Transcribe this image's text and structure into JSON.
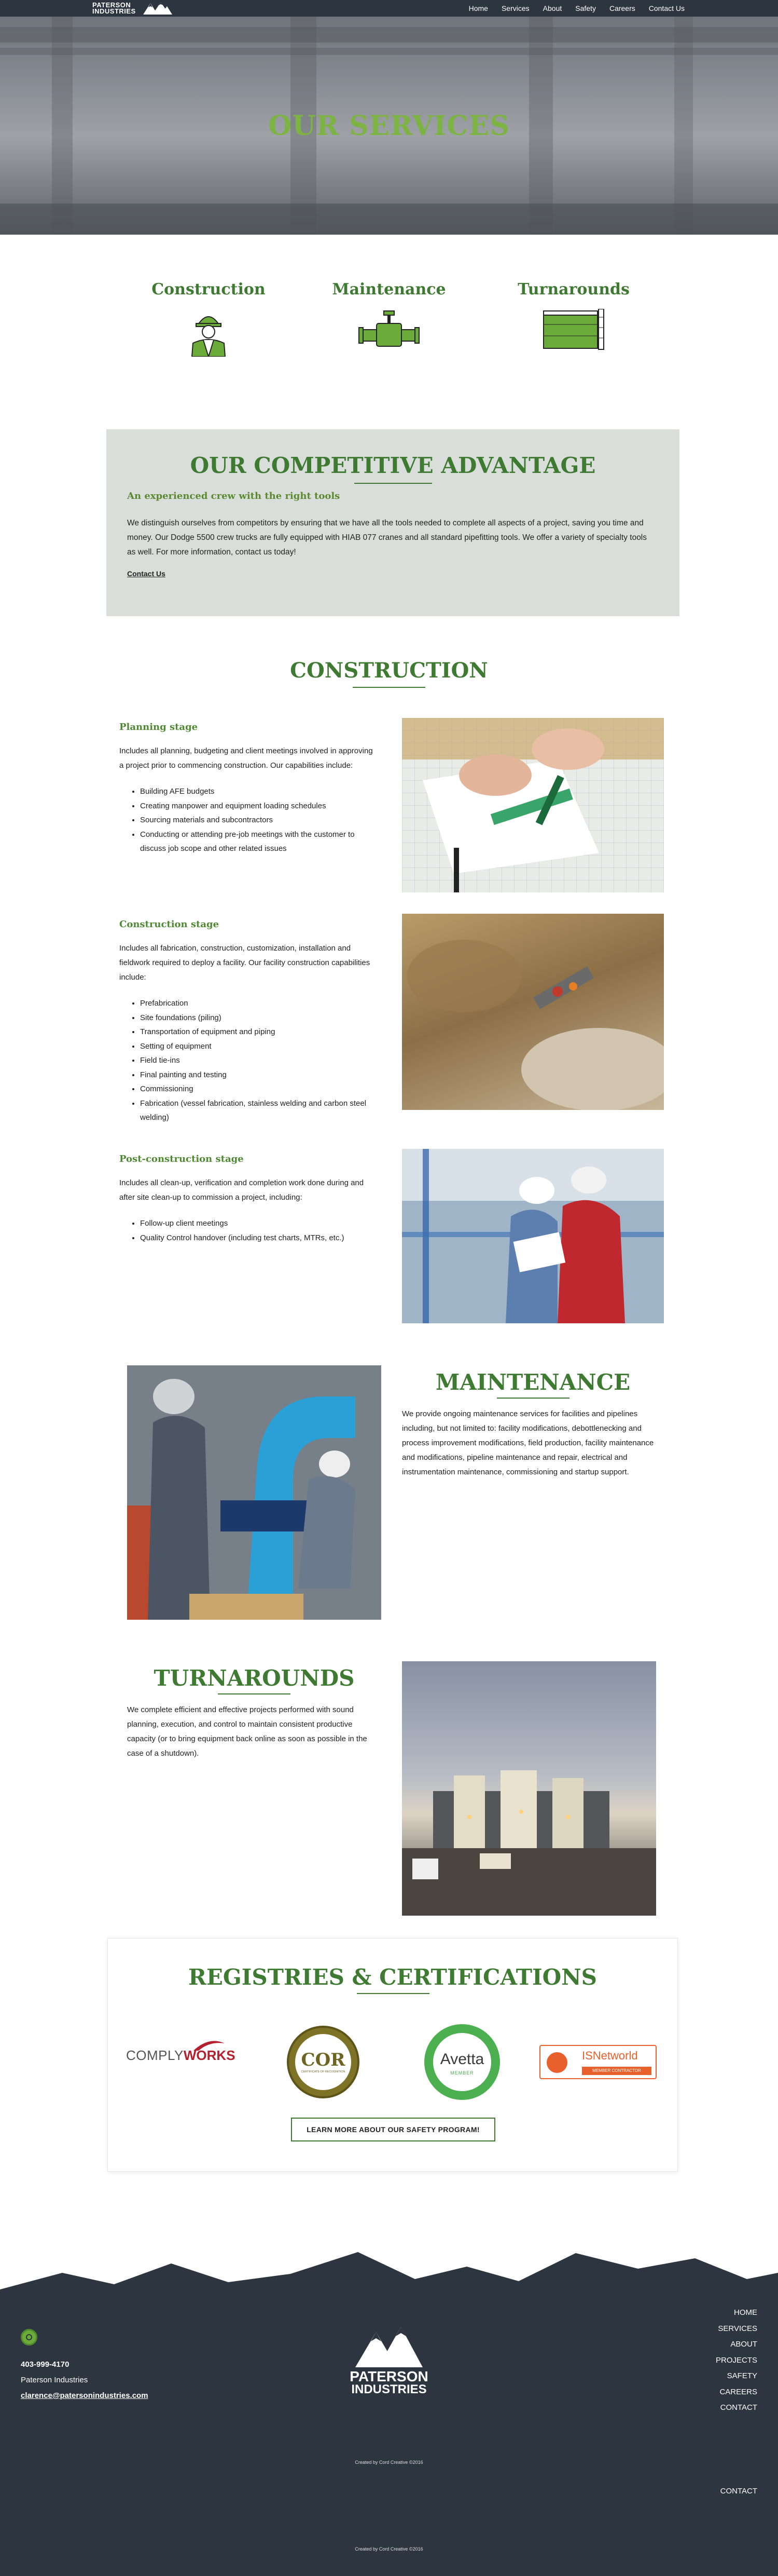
{
  "nav": {
    "logo_top": "PATERSON",
    "logo_bottom": "INDUSTRIES",
    "items": [
      "Home",
      "Services",
      "About",
      "Safety",
      "Careers",
      "Contact Us"
    ]
  },
  "hero": {
    "title": "OUR SERVICES"
  },
  "services": [
    {
      "label": "Construction",
      "icon": "worker-icon"
    },
    {
      "label": "Maintenance",
      "icon": "valve-icon"
    },
    {
      "label": "Turnarounds",
      "icon": "tank-icon"
    }
  ],
  "advantage": {
    "title": "OUR COMPETITIVE ADVANTAGE",
    "subtitle": "An experienced crew with the right tools",
    "body": "We distinguish ourselves from competitors by ensuring that we have all the tools needed to complete all aspects of a project, saving you time and money. Our Dodge 5500 crew trucks are fully equipped with HIAB 077 cranes and all standard pipefitting tools. We offer a variety of specialty tools as well. For more information, contact us today!",
    "link": "Contact Us"
  },
  "construction": {
    "title": "CONSTRUCTION",
    "stages": [
      {
        "title": "Planning stage",
        "body": "Includes all planning, budgeting and client meetings involved in approving a project prior to commencing construction. Our capabilities include:",
        "items": [
          "Building AFE budgets",
          "Creating manpower and equipment loading schedules",
          "Sourcing materials and subcontractors",
          "Conducting or attending pre-job meetings with the customer to discuss job scope and other related issues"
        ]
      },
      {
        "title": "Construction stage",
        "body": "Includes all fabrication, construction, customization, installation and fieldwork required to deploy a facility. Our facility construction capabilities include:",
        "items": [
          "Prefabrication",
          "Site foundations (piling)",
          "Transportation of equipment and piping",
          "Setting of equipment",
          "Field tie-ins",
          "Final painting and testing",
          "Commissioning",
          "Fabrication (vessel fabrication, stainless welding and carbon steel welding)"
        ]
      },
      {
        "title": "Post-construction stage",
        "body": "Includes all clean-up, verification and completion work done during and after site clean-up to commission a project, including:",
        "items": [
          "Follow-up client meetings",
          "Quality Control handover (including test charts, MTRs, etc.)"
        ]
      }
    ]
  },
  "maintenance": {
    "title": "MAINTENANCE",
    "body": "We provide ongoing maintenance services for facilities and pipelines including, but not limited to: facility modifications, debottlenecking and process improvement modifications, field production, facility maintenance and modifications, pipeline maintenance and repair, electrical and instrumentation maintenance, commissioning and startup support."
  },
  "turnarounds": {
    "title": "TURNAROUNDS",
    "body": "We complete efficient and effective projects performed with sound planning, execution, and control to maintain consistent productive capacity (or to bring equipment back online as soon as possible in the case of a shutdown)."
  },
  "registries": {
    "title": "REGISTRIES & CERTIFICATIONS",
    "logos": {
      "comply_a": "COMPLY",
      "comply_b": "WORKS",
      "cor": "COR",
      "cor_ring": "CERTIFICATE OF RECOGNITION",
      "avetta": "Avetta",
      "avetta_sub": "MEMBER",
      "isn": "ISNetworld",
      "isn_sub": "MEMBER CONTRACTOR"
    },
    "button": "LEARN MORE ABOUT OUR SAFETY PROGRAM!"
  },
  "footer": {
    "nav": [
      "HOME",
      "SERVICES",
      "ABOUT",
      "PROJECTS",
      "SAFETY",
      "CAREERS",
      "CONTACT"
    ],
    "phone": "403-999-4170",
    "company": "Paterson Industries",
    "email": "clarence@patersonindustries.com",
    "logo_top": "PATERSON",
    "logo_bottom": "INDUSTRIES",
    "credit1": "Created by Cord Creative ©2016",
    "contact2": "CONTACT",
    "credit2": "Created by Cord Creative ©2016"
  }
}
